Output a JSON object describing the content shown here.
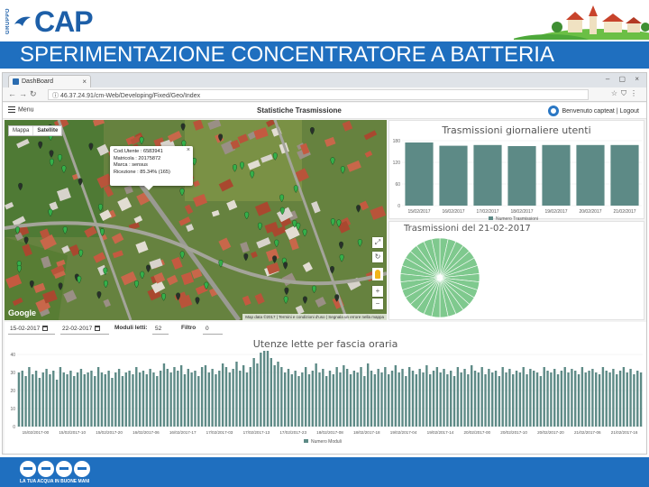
{
  "brand": {
    "group_label": "GRUPPO",
    "name": "CAP",
    "accent": "#1f6fbf",
    "footer_tagline": "LA TUA ACQUA IN BUONE MANI"
  },
  "slide_title": "SPERIMENTAZIONE CONCENTRATORE A BATTERIA",
  "browser": {
    "tab_title": "DashBoard",
    "url": "46.37.24.91/cm-Web/Developing/Fixed/Geo/Index",
    "icons": [
      "back-icon",
      "forward-icon",
      "reload-icon",
      "info-icon",
      "star-icon",
      "shield-icon",
      "menu-icon"
    ]
  },
  "app": {
    "menu_label": "Menu",
    "title": "Statistiche Trasmissione",
    "welcome": "Benvenuto capteat | Logout"
  },
  "map": {
    "type_options": [
      "Mappa",
      "Satellite"
    ],
    "selected_type": "Satellite",
    "info_window": {
      "line1": "Cod.Utente : 6583941",
      "line2": "Matricola : 20175872",
      "line3": "Marca : sensus",
      "line4": "Ricezione : 85.34% (165)"
    },
    "google_label": "Google",
    "attribution": "Map data ©2017 | Termini e condizioni d'uso | Segnala un errore nella mappa",
    "controls": [
      "fullscreen-icon",
      "rotate-icon",
      "pegman-icon",
      "zoom-in-icon",
      "zoom-out-icon"
    ]
  },
  "chart_data": [
    {
      "type": "bar",
      "title": "Trasmissioni giornaliere utenti",
      "categories": [
        "15/02/2017",
        "16/02/2017",
        "17/02/2017",
        "18/02/2017",
        "19/02/2017",
        "20/02/2017",
        "21/02/2017"
      ],
      "series": [
        {
          "name": "Numero Trasmissioni",
          "values": [
            175,
            166,
            168,
            165,
            168,
            168,
            168
          ]
        }
      ],
      "ylim": [
        0,
        180
      ],
      "yticks": [
        "180",
        "120",
        "60",
        "0"
      ],
      "color": "#5d8a86"
    },
    {
      "type": "pie",
      "title": "Trasmissioni del 21-02-2017",
      "slices": 30,
      "color": "#7fc98e"
    },
    {
      "type": "bar",
      "title": "Utenze lette per fascia oraria",
      "series": [
        {
          "name": "Numero Moduli",
          "values": [
            30,
            31,
            28,
            33,
            29,
            31,
            27,
            30,
            32,
            29,
            31,
            26,
            33,
            30,
            29,
            31,
            28,
            30,
            32,
            29,
            30,
            31,
            28,
            33,
            30,
            29,
            31,
            27,
            30,
            32,
            28,
            30,
            31,
            29,
            33,
            30,
            31,
            29,
            32,
            30,
            28,
            31,
            35,
            32,
            30,
            33,
            31,
            34,
            29,
            32,
            30,
            31,
            28,
            33,
            34,
            30,
            32,
            29,
            31,
            35,
            33,
            30,
            32,
            36,
            31,
            34,
            30,
            33,
            38,
            35,
            41,
            46,
            43,
            38,
            34,
            36,
            33,
            30,
            32,
            29,
            31,
            28,
            30,
            33,
            29,
            31,
            35,
            30,
            32,
            28,
            31,
            29,
            33,
            30,
            34,
            32,
            29,
            31,
            30,
            33,
            28,
            35,
            31,
            29,
            32,
            30,
            33,
            29,
            31,
            34,
            30,
            32,
            28,
            33,
            31,
            29,
            32,
            30,
            34,
            29,
            31,
            33,
            30,
            32,
            29,
            31,
            28,
            33,
            30,
            32,
            29,
            34,
            31,
            30,
            33,
            29,
            32,
            30,
            31,
            28,
            33,
            30,
            32,
            29,
            31,
            30,
            33,
            29,
            32,
            31,
            30,
            28,
            33,
            31,
            30,
            32,
            29,
            31,
            33,
            30,
            32,
            31,
            29,
            33,
            30,
            31,
            32,
            30,
            29,
            33,
            31,
            30,
            32,
            29,
            31,
            33,
            30,
            32,
            29,
            31,
            30
          ]
        }
      ],
      "ylim": [
        0,
        40
      ],
      "yticks": [
        "40",
        "30",
        "20",
        "10",
        "0"
      ],
      "xlabels": [
        "15/02/2017-00",
        "15/02/2017-10",
        "15/02/2017-20",
        "16/02/2017-06",
        "16/02/2017-17",
        "17/02/2017-03",
        "17/02/2017-13",
        "17/02/2017-23",
        "18/02/2017-08",
        "18/02/2017-18",
        "19/02/2017-04",
        "19/02/2017-14",
        "20/02/2017-00",
        "20/02/2017-10",
        "20/02/2017-20",
        "21/02/2017-06",
        "21/02/2017-16"
      ],
      "color": "#5d8a86"
    }
  ],
  "filters": {
    "date_from": "15-02-2017",
    "date_to": "22-02-2017",
    "moduli_label": "Moduli letti:",
    "moduli_value": "52",
    "filtro_label": "Filtro",
    "filtro_value": "0"
  }
}
